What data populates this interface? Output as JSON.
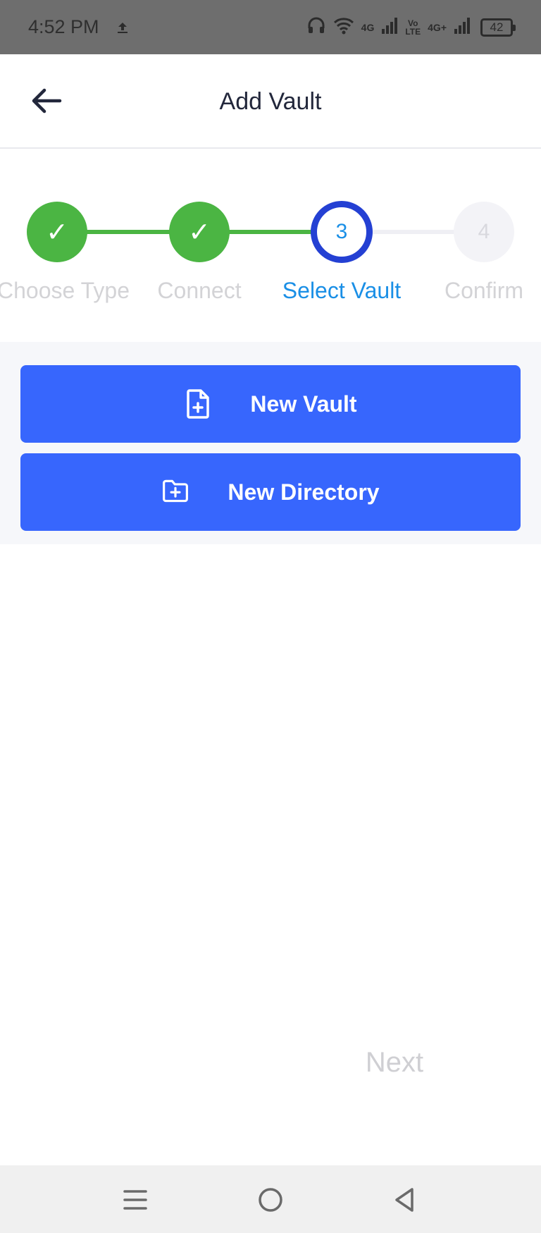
{
  "status_bar": {
    "time": "4:52 PM",
    "network_1": "4G",
    "volte": [
      "Vo",
      "LTE"
    ],
    "network_2": "4G+",
    "battery": "42"
  },
  "header": {
    "title": "Add Vault"
  },
  "stepper": {
    "steps": [
      {
        "label": "Choose Type",
        "marker": "✓",
        "state": "done"
      },
      {
        "label": "Connect",
        "marker": "✓",
        "state": "done"
      },
      {
        "label": "Select Vault",
        "marker": "3",
        "state": "current"
      },
      {
        "label": "Confirm",
        "marker": "4",
        "state": "pending"
      }
    ]
  },
  "actions": {
    "new_vault": "New Vault",
    "new_directory": "New Directory"
  },
  "footer": {
    "next": "Next"
  },
  "colors": {
    "accent": "#3766fd",
    "done": "#4bb543",
    "current_ring": "#2440d3",
    "current_text": "#1a8fe6"
  }
}
